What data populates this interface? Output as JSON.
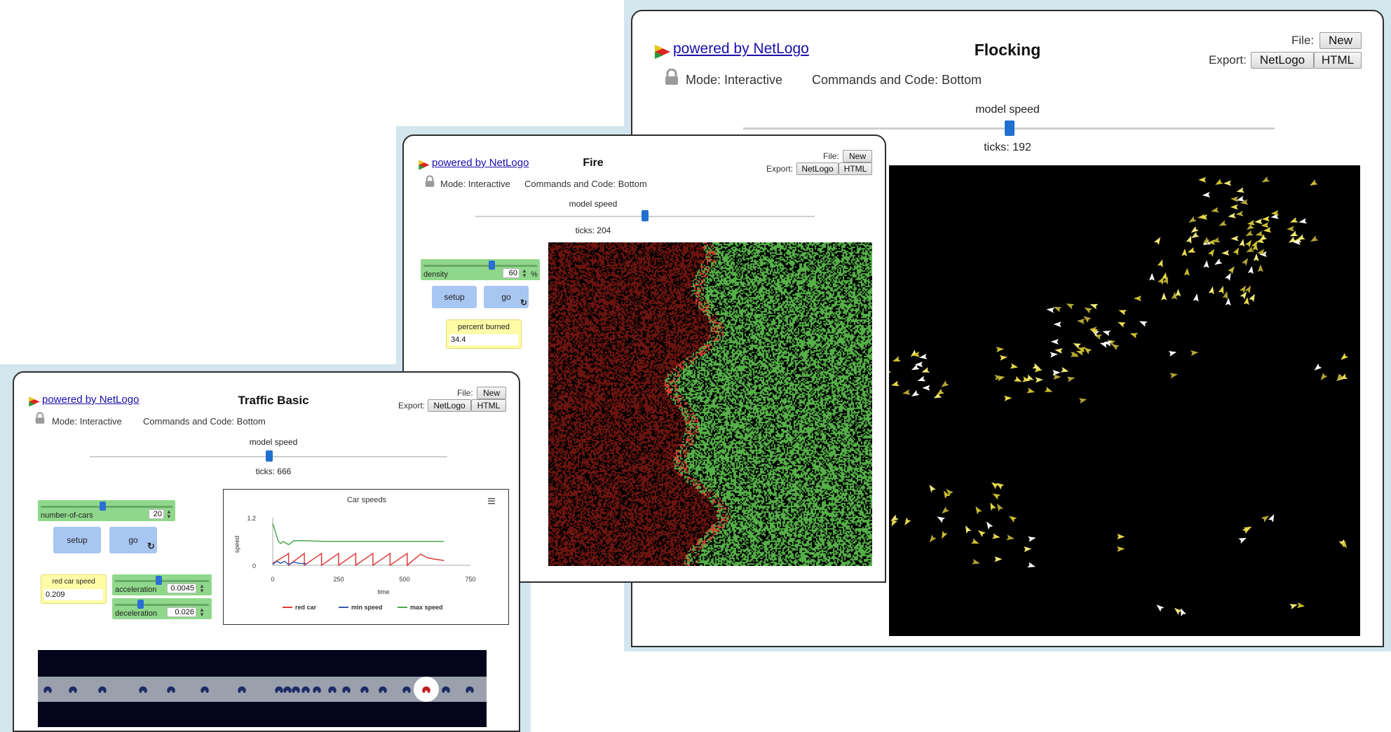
{
  "common": {
    "powered_by": "powered by NetLogo",
    "file_label": "File:",
    "export_label": "Export:",
    "new_button": "New",
    "netlogo_button": "NetLogo",
    "html_button": "HTML",
    "mode_label": "Mode: Interactive",
    "commands_label": "Commands and Code: Bottom",
    "model_speed_label": "model speed"
  },
  "flocking": {
    "title": "Flocking",
    "ticks": "ticks: 192"
  },
  "fire": {
    "title": "Fire",
    "ticks": "ticks: 204",
    "density": {
      "name": "density",
      "value": "60",
      "unit": "%",
      "fraction": 0.6
    },
    "setup_button": "setup",
    "go_button": "go",
    "monitor": {
      "name": "percent burned",
      "value": "34.4"
    }
  },
  "traffic": {
    "title": "Traffic Basic",
    "ticks": "ticks: 666",
    "number_of_cars": {
      "name": "number-of-cars",
      "value": "20",
      "fraction": 0.5
    },
    "setup_button": "setup",
    "go_button": "go",
    "red_car_speed": {
      "name": "red car speed",
      "value": "0.209"
    },
    "acceleration": {
      "name": "acceleration",
      "value": "0.0045",
      "fraction": 0.45
    },
    "deceleration": {
      "name": "deceleration",
      "value": "0.026",
      "fraction": 0.26
    }
  },
  "colors": {
    "backdrop": "#d3e6ee",
    "slider_green": "#8fd88b",
    "button_blue": "#a8c6f2",
    "monitor_yellow": "#fffca8",
    "tree_green": "#55b048",
    "burnt_red": "#6b1410",
    "boid_yellow": "#e8d94a",
    "road_gray": "#9aa0ac"
  },
  "chart_data": {
    "type": "line",
    "title": "Car speeds",
    "xlabel": "time",
    "ylabel": "speed",
    "xlim": [
      0,
      750
    ],
    "ylim": [
      0,
      1.2
    ],
    "x_ticks": [
      "0",
      "250",
      "500",
      "750"
    ],
    "y_ticks": [
      "0",
      "1.2"
    ],
    "menu_icon": "hamburger-icon",
    "series": [
      {
        "name": "red car",
        "color": "#e03a3a",
        "points": [
          [
            0,
            0.05
          ],
          [
            50,
            0.25
          ],
          [
            60,
            0.3
          ],
          [
            60,
            0
          ],
          [
            120,
            0.3
          ],
          [
            120,
            0
          ],
          [
            185,
            0.3
          ],
          [
            185,
            0
          ],
          [
            250,
            0.3
          ],
          [
            250,
            0
          ],
          [
            315,
            0.3
          ],
          [
            315,
            0
          ],
          [
            380,
            0.3
          ],
          [
            380,
            0
          ],
          [
            445,
            0.3
          ],
          [
            445,
            0
          ],
          [
            510,
            0.3
          ],
          [
            510,
            0
          ],
          [
            560,
            0.28
          ],
          [
            590,
            0.18
          ],
          [
            650,
            0.12
          ]
        ]
      },
      {
        "name": "min speed",
        "color": "#3a5bb0",
        "points": [
          [
            0,
            0.02
          ],
          [
            15,
            0.1
          ],
          [
            30,
            0.05
          ],
          [
            45,
            0.1
          ],
          [
            60,
            0.02
          ],
          [
            80,
            0.08
          ],
          [
            100,
            0.05
          ],
          [
            130,
            0.04
          ]
        ]
      },
      {
        "name": "max speed",
        "color": "#4aa84a",
        "points": [
          [
            0,
            1.05
          ],
          [
            10,
            0.85
          ],
          [
            20,
            0.62
          ],
          [
            30,
            0.55
          ],
          [
            40,
            0.6
          ],
          [
            60,
            0.52
          ],
          [
            80,
            0.62
          ],
          [
            120,
            0.62
          ],
          [
            200,
            0.6
          ],
          [
            300,
            0.6
          ],
          [
            400,
            0.6
          ],
          [
            500,
            0.6
          ],
          [
            600,
            0.6
          ],
          [
            650,
            0.6
          ]
        ]
      }
    ]
  }
}
